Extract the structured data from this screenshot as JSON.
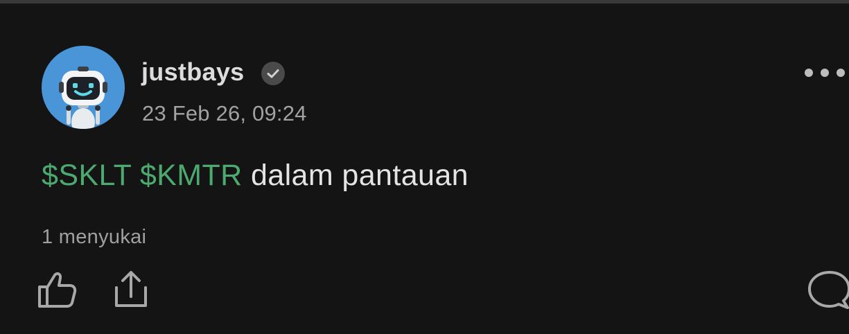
{
  "post": {
    "author": {
      "username": "justbays",
      "verified": true,
      "avatar": "robot-avatar-icon"
    },
    "timestamp": "23 Feb 26, 09:24",
    "content": {
      "tickers": [
        "$SKLT",
        "$KMTR"
      ],
      "text": "dalam pantauan"
    },
    "likes_text": "1 menyukai",
    "actions": {
      "like": "thumbs-up-icon",
      "share": "share-icon",
      "comment": "comment-icon",
      "more": "more-options-icon"
    }
  },
  "colors": {
    "background": "#141414",
    "ticker": "#4caa70",
    "text": "#e4e4e4",
    "muted": "#a2a2a2",
    "avatar_bg": "#4a95d8"
  }
}
